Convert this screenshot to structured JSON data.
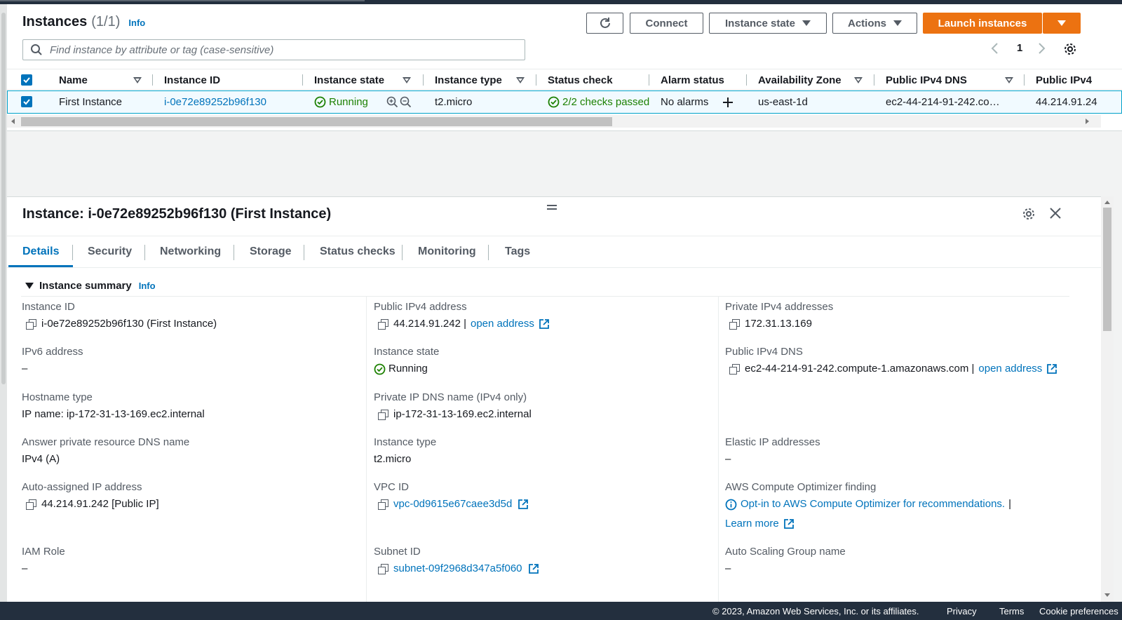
{
  "instances": {
    "title": "Instances",
    "count": "(1/1)",
    "info": "Info",
    "buttons": {
      "connect": "Connect",
      "instance_state": "Instance state",
      "actions": "Actions",
      "launch": "Launch instances"
    },
    "search_placeholder": "Find instance by attribute or tag (case-sensitive)",
    "page": "1",
    "columns": [
      "Name",
      "Instance ID",
      "Instance state",
      "Instance type",
      "Status check",
      "Alarm status",
      "Availability Zone",
      "Public IPv4 DNS",
      "Public IPv4"
    ],
    "row": {
      "name": "First Instance",
      "instance_id": "i-0e72e89252b96f130",
      "state": "Running",
      "type": "t2.micro",
      "status_check": "2/2 checks passed",
      "alarm": "No alarms",
      "az": "us-east-1d",
      "dns": "ec2-44-214-91-242.co…",
      "ipv4": "44.214.91.24"
    }
  },
  "details": {
    "title": "Instance: i-0e72e89252b96f130 (First Instance)",
    "tabs": [
      "Details",
      "Security",
      "Networking",
      "Storage",
      "Status checks",
      "Monitoring",
      "Tags"
    ],
    "summary_heading": "Instance summary",
    "info": "Info",
    "col1": {
      "instance_id_label": "Instance ID",
      "instance_id_value": "i-0e72e89252b96f130 (First Instance)",
      "ipv6_label": "IPv6 address",
      "ipv6_value": "–",
      "hostname_label": "Hostname type",
      "hostname_value": "IP name: ip-172-31-13-169.ec2.internal",
      "answer_dns_label": "Answer private resource DNS name",
      "answer_dns_value": "IPv4 (A)",
      "auto_ip_label": "Auto-assigned IP address",
      "auto_ip_value": "44.214.91.242 [Public IP]",
      "iam_label": "IAM Role",
      "iam_value": "–"
    },
    "col2": {
      "public_ip_label": "Public IPv4 address",
      "public_ip_value": "44.214.91.242 |",
      "open_address": "open address",
      "state_label": "Instance state",
      "state_value": "Running",
      "private_dns_label": "Private IP DNS name (IPv4 only)",
      "private_dns_value": "ip-172-31-13-169.ec2.internal",
      "type_label": "Instance type",
      "type_value": "t2.micro",
      "vpc_label": "VPC ID",
      "vpc_value": "vpc-0d9615e67caee3d5d",
      "subnet_label": "Subnet ID",
      "subnet_value": "subnet-09f2968d347a5f060"
    },
    "col3": {
      "private_ip_label": "Private IPv4 addresses",
      "private_ip_value": "172.31.13.169",
      "public_dns_label": "Public IPv4 DNS",
      "public_dns_value": "ec2-44-214-91-242.compute-1.amazonaws.com |",
      "open_address": "open address",
      "elastic_label": "Elastic IP addresses",
      "elastic_value": "–",
      "optimizer_label": "AWS Compute Optimizer finding",
      "optimizer_value": "Opt-in to AWS Compute Optimizer for recommendations.",
      "optimizer_sep": "|",
      "learn_more": "Learn more",
      "asg_label": "Auto Scaling Group name",
      "asg_value": "–"
    }
  },
  "footer": {
    "copyright": "© 2023, Amazon Web Services, Inc. or its affiliates.",
    "privacy": "Privacy",
    "terms": "Terms",
    "cookies": "Cookie preferences"
  },
  "colors": {
    "primary": "#ec7211",
    "link": "#0073bb",
    "success": "#1d8102",
    "header_bg": "#232f3e"
  }
}
